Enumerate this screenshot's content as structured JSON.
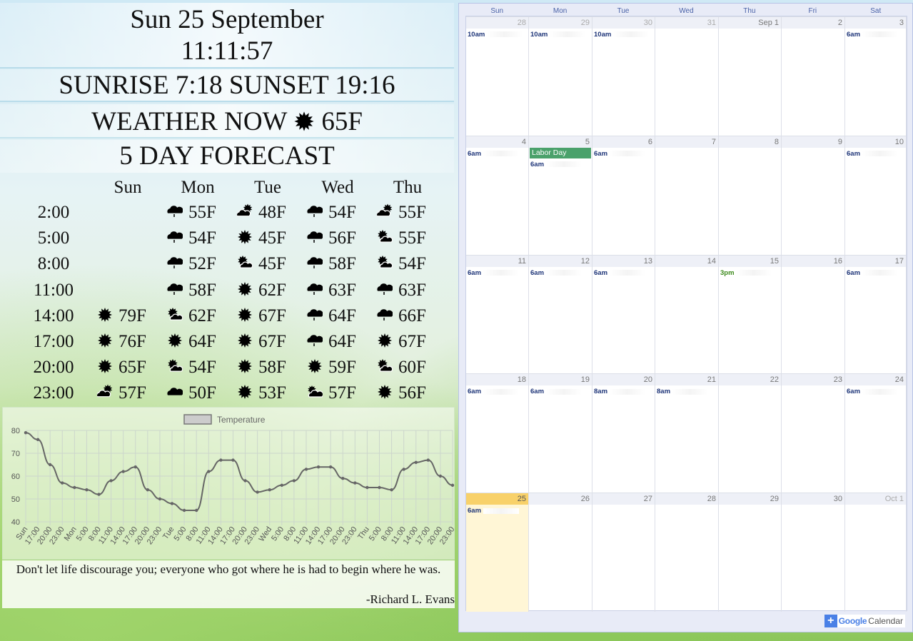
{
  "header": {
    "date": "Sun 25 September",
    "time": "11:11:57",
    "sun": "SUNRISE 7:18 SUNSET 19:16",
    "weather_now_label": "WEATHER NOW",
    "weather_now_icon": "sunny-icon",
    "weather_now_temp": "65F",
    "forecast_title": "5 DAY FORECAST"
  },
  "forecast": {
    "days": [
      "Sun",
      "Mon",
      "Tue",
      "Wed",
      "Thu"
    ],
    "rows": [
      {
        "time": "2:00",
        "cells": [
          null,
          {
            "icon": "rain",
            "temp": "55F"
          },
          {
            "icon": "partly-cloudy",
            "temp": "48F"
          },
          {
            "icon": "rain",
            "temp": "54F"
          },
          {
            "icon": "partly-cloudy",
            "temp": "55F"
          }
        ]
      },
      {
        "time": "5:00",
        "cells": [
          null,
          {
            "icon": "rain",
            "temp": "54F"
          },
          {
            "icon": "sunny",
            "temp": "45F"
          },
          {
            "icon": "rain",
            "temp": "56F"
          },
          {
            "icon": "mostly-sunny",
            "temp": "55F"
          }
        ]
      },
      {
        "time": "8:00",
        "cells": [
          null,
          {
            "icon": "rain",
            "temp": "52F"
          },
          {
            "icon": "mostly-sunny",
            "temp": "45F"
          },
          {
            "icon": "rain",
            "temp": "58F"
          },
          {
            "icon": "mostly-sunny",
            "temp": "54F"
          }
        ]
      },
      {
        "time": "11:00",
        "cells": [
          null,
          {
            "icon": "rain",
            "temp": "58F"
          },
          {
            "icon": "sunny",
            "temp": "62F"
          },
          {
            "icon": "rain",
            "temp": "63F"
          },
          {
            "icon": "rain",
            "temp": "63F"
          }
        ]
      },
      {
        "time": "14:00",
        "cells": [
          {
            "icon": "sunny",
            "temp": "79F"
          },
          {
            "icon": "mostly-sunny",
            "temp": "62F"
          },
          {
            "icon": "sunny",
            "temp": "67F"
          },
          {
            "icon": "rain",
            "temp": "64F"
          },
          {
            "icon": "rain",
            "temp": "66F"
          }
        ]
      },
      {
        "time": "17:00",
        "cells": [
          {
            "icon": "sunny",
            "temp": "76F"
          },
          {
            "icon": "sunny",
            "temp": "64F"
          },
          {
            "icon": "sunny",
            "temp": "67F"
          },
          {
            "icon": "rain",
            "temp": "64F"
          },
          {
            "icon": "sunny",
            "temp": "67F"
          }
        ]
      },
      {
        "time": "20:00",
        "cells": [
          {
            "icon": "sunny",
            "temp": "65F"
          },
          {
            "icon": "mostly-sunny",
            "temp": "54F"
          },
          {
            "icon": "sunny",
            "temp": "58F"
          },
          {
            "icon": "sunny",
            "temp": "59F"
          },
          {
            "icon": "mostly-sunny",
            "temp": "60F"
          }
        ]
      },
      {
        "time": "23:00",
        "cells": [
          {
            "icon": "partly-cloudy",
            "temp": "57F"
          },
          {
            "icon": "cloudy",
            "temp": "50F"
          },
          {
            "icon": "sunny",
            "temp": "53F"
          },
          {
            "icon": "mostly-cloudy",
            "temp": "57F"
          },
          {
            "icon": "sunny",
            "temp": "56F"
          }
        ]
      }
    ]
  },
  "chart_data": {
    "type": "line",
    "legend": [
      "Temperature"
    ],
    "legend_position": "top",
    "series": [
      {
        "name": "Temperature",
        "values": [
          79,
          76,
          65,
          57,
          55,
          54,
          52,
          58,
          62,
          64,
          54,
          50,
          48,
          45,
          45,
          62,
          67,
          67,
          58,
          53,
          54,
          56,
          58,
          63,
          64,
          64,
          59,
          57,
          55,
          55,
          54,
          63,
          66,
          67,
          60,
          56
        ]
      }
    ],
    "categories": [
      "Sun",
      "17:00",
      "20:00",
      "23:00",
      "Mon",
      "5:00",
      "8:00",
      "11:00",
      "14:00",
      "17:00",
      "20:00",
      "23:00",
      "Tue",
      "5:00",
      "8:00",
      "11:00",
      "14:00",
      "17:00",
      "20:00",
      "23:00",
      "Wed",
      "5:00",
      "8:00",
      "11:00",
      "14:00",
      "17:00",
      "20:00",
      "23:00",
      "Thu",
      "5:00",
      "8:00",
      "11:00",
      "14:00",
      "17:00",
      "20:00",
      "23:00"
    ],
    "yticks": [
      40,
      50,
      60,
      70,
      80
    ],
    "ylim": [
      40,
      80
    ],
    "grid": true,
    "color": "#666666"
  },
  "quote": {
    "text": "Don't let life discourage you; everyone who got where he is had to begin where he was.",
    "author": "-Richard L. Evans"
  },
  "calendar": {
    "weekdays": [
      "Sun",
      "Mon",
      "Tue",
      "Wed",
      "Thu",
      "Fri",
      "Sat"
    ],
    "weeks": [
      [
        {
          "n": "28",
          "other": true,
          "ev": [
            "10am"
          ]
        },
        {
          "n": "29",
          "other": true,
          "ev": [
            "10am"
          ]
        },
        {
          "n": "30",
          "other": true,
          "ev": [
            "10am"
          ]
        },
        {
          "n": "31",
          "other": true,
          "ev": []
        },
        {
          "n": "Sep 1",
          "ev": []
        },
        {
          "n": "2",
          "ev": []
        },
        {
          "n": "3",
          "ev": [
            "6am"
          ]
        }
      ],
      [
        {
          "n": "4",
          "ev": [
            "6am"
          ]
        },
        {
          "n": "5",
          "allday": "Labor Day",
          "ev": [
            "6am"
          ]
        },
        {
          "n": "6",
          "ev": [
            "6am"
          ]
        },
        {
          "n": "7",
          "ev": []
        },
        {
          "n": "8",
          "ev": []
        },
        {
          "n": "9",
          "ev": []
        },
        {
          "n": "10",
          "ev": [
            "6am"
          ]
        }
      ],
      [
        {
          "n": "11",
          "ev": [
            "6am"
          ]
        },
        {
          "n": "12",
          "ev": [
            "6am"
          ]
        },
        {
          "n": "13",
          "ev": [
            "6am"
          ]
        },
        {
          "n": "14",
          "ev": []
        },
        {
          "n": "15",
          "ev": [
            "3pm"
          ],
          "green": true
        },
        {
          "n": "16",
          "ev": []
        },
        {
          "n": "17",
          "ev": [
            "6am"
          ]
        }
      ],
      [
        {
          "n": "18",
          "ev": [
            "6am"
          ]
        },
        {
          "n": "19",
          "ev": [
            "6am"
          ]
        },
        {
          "n": "20",
          "ev": [
            "8am"
          ]
        },
        {
          "n": "21",
          "ev": [
            "8am"
          ]
        },
        {
          "n": "22",
          "ev": []
        },
        {
          "n": "23",
          "ev": []
        },
        {
          "n": "24",
          "ev": [
            "6am"
          ]
        }
      ],
      [
        {
          "n": "25",
          "today": true,
          "ev": [
            "6am"
          ]
        },
        {
          "n": "26",
          "ev": []
        },
        {
          "n": "27",
          "ev": []
        },
        {
          "n": "28",
          "ev": []
        },
        {
          "n": "29",
          "ev": []
        },
        {
          "n": "30",
          "ev": []
        },
        {
          "n": "Oct 1",
          "other": true,
          "ev": []
        }
      ]
    ],
    "logo_google": "Google",
    "logo_calendar": "Calendar"
  }
}
